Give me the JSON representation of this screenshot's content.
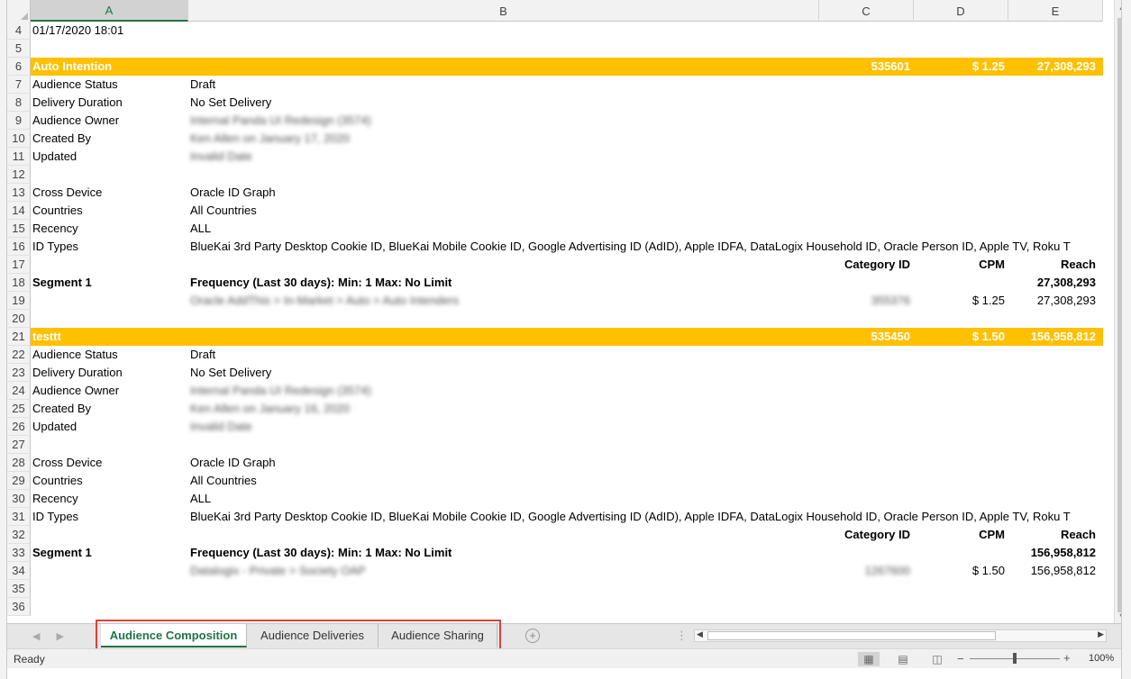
{
  "columns": [
    "A",
    "B",
    "C",
    "D",
    "E"
  ],
  "selected_column": "A",
  "rows": [
    {
      "n": "4",
      "a": "01/17/2020 18:01",
      "b": "",
      "c": "",
      "d": "",
      "e": ""
    },
    {
      "n": "5",
      "a": "",
      "b": "",
      "c": "",
      "d": "",
      "e": ""
    },
    {
      "n": "6",
      "a": "Auto Intention",
      "b": "",
      "c": "535601",
      "d": "$ 1.25",
      "e": "27,308,293",
      "style": "highlight"
    },
    {
      "n": "7",
      "a": "Audience Status",
      "b": "Draft",
      "c": "",
      "d": "",
      "e": ""
    },
    {
      "n": "8",
      "a": "Delivery Duration",
      "b": "No Set Delivery",
      "c": "",
      "d": "",
      "e": ""
    },
    {
      "n": "9",
      "a": "Audience Owner",
      "b": "Internal Panda UI Redesign (3574)",
      "c": "",
      "d": "",
      "e": "",
      "blur_b": true
    },
    {
      "n": "10",
      "a": "Created By",
      "b": "Ken Allen on January 17, 2020",
      "c": "",
      "d": "",
      "e": "",
      "blur_b": true
    },
    {
      "n": "11",
      "a": "Updated",
      "b": "Invalid Date",
      "c": "",
      "d": "",
      "e": "",
      "blur_b": true
    },
    {
      "n": "12",
      "a": "",
      "b": "",
      "c": "",
      "d": "",
      "e": ""
    },
    {
      "n": "13",
      "a": "Cross Device",
      "b": "Oracle ID Graph",
      "c": "",
      "d": "",
      "e": ""
    },
    {
      "n": "14",
      "a": "Countries",
      "b": "All Countries",
      "c": "",
      "d": "",
      "e": ""
    },
    {
      "n": "15",
      "a": "Recency",
      "b": "ALL",
      "c": "",
      "d": "",
      "e": ""
    },
    {
      "n": "16",
      "a": "ID Types",
      "b": "BlueKai 3rd Party Desktop Cookie ID, BlueKai Mobile Cookie ID, Google Advertising ID (AdID), Apple IDFA, DataLogix Household ID, Oracle Person ID, Apple TV, Roku T",
      "c": "",
      "d": "",
      "e": ""
    },
    {
      "n": "17",
      "a": "",
      "b": "",
      "c": "Category ID",
      "d": "CPM",
      "e": "Reach",
      "style": "subhead"
    },
    {
      "n": "18",
      "a": "Segment 1",
      "b": "Frequency (Last 30 days): Min: 1 Max: No Limit",
      "c": "",
      "d": "",
      "e": "27,308,293",
      "style": "bold"
    },
    {
      "n": "19",
      "a": "",
      "b": "Oracle AddThis > In-Market > Auto > Auto Intenders",
      "c": "355376",
      "d": "$ 1.25",
      "e": "27,308,293",
      "blur_b": true,
      "blur_c": true
    },
    {
      "n": "20",
      "a": "",
      "b": "",
      "c": "",
      "d": "",
      "e": ""
    },
    {
      "n": "21",
      "a": "testtt",
      "b": "",
      "c": "535450",
      "d": "$ 1.50",
      "e": "156,958,812",
      "style": "highlight"
    },
    {
      "n": "22",
      "a": "Audience Status",
      "b": "Draft",
      "c": "",
      "d": "",
      "e": ""
    },
    {
      "n": "23",
      "a": "Delivery Duration",
      "b": "No Set Delivery",
      "c": "",
      "d": "",
      "e": ""
    },
    {
      "n": "24",
      "a": "Audience Owner",
      "b": "Internal Panda UI Redesign (3574)",
      "c": "",
      "d": "",
      "e": "",
      "blur_b": true
    },
    {
      "n": "25",
      "a": "Created By",
      "b": "Ken Allen on January 16, 2020",
      "c": "",
      "d": "",
      "e": "",
      "blur_b": true
    },
    {
      "n": "26",
      "a": "Updated",
      "b": "Invalid Date",
      "c": "",
      "d": "",
      "e": "",
      "blur_b": true
    },
    {
      "n": "27",
      "a": "",
      "b": "",
      "c": "",
      "d": "",
      "e": ""
    },
    {
      "n": "28",
      "a": "Cross Device",
      "b": "Oracle ID Graph",
      "c": "",
      "d": "",
      "e": ""
    },
    {
      "n": "29",
      "a": "Countries",
      "b": "All Countries",
      "c": "",
      "d": "",
      "e": ""
    },
    {
      "n": "30",
      "a": "Recency",
      "b": "ALL",
      "c": "",
      "d": "",
      "e": ""
    },
    {
      "n": "31",
      "a": "ID Types",
      "b": "BlueKai 3rd Party Desktop Cookie ID, BlueKai Mobile Cookie ID, Google Advertising ID (AdID), Apple IDFA, DataLogix Household ID, Oracle Person ID, Apple TV, Roku T",
      "c": "",
      "d": "",
      "e": ""
    },
    {
      "n": "32",
      "a": "",
      "b": "",
      "c": "Category ID",
      "d": "CPM",
      "e": "Reach",
      "style": "subhead"
    },
    {
      "n": "33",
      "a": "Segment 1",
      "b": "Frequency (Last 30 days): Min: 1 Max: No Limit",
      "c": "",
      "d": "",
      "e": "156,958,812",
      "style": "bold"
    },
    {
      "n": "34",
      "a": "",
      "b": "Datalogix - Private > Society OAP",
      "c": "1267600",
      "d": "$ 1.50",
      "e": "156,958,812",
      "blur_b": true,
      "blur_c": true
    },
    {
      "n": "35",
      "a": "",
      "b": "",
      "c": "",
      "d": "",
      "e": ""
    },
    {
      "n": "36",
      "a": "",
      "b": "",
      "c": "",
      "d": "",
      "e": ""
    }
  ],
  "tabs": [
    {
      "label": "Audience Composition",
      "active": true
    },
    {
      "label": "Audience Deliveries",
      "active": false
    },
    {
      "label": "Audience Sharing",
      "active": false
    }
  ],
  "status": {
    "ready": "Ready",
    "zoom": "100%"
  },
  "colors": {
    "highlight": "#ffc000",
    "accent": "#217346",
    "callout": "#e0403a"
  }
}
